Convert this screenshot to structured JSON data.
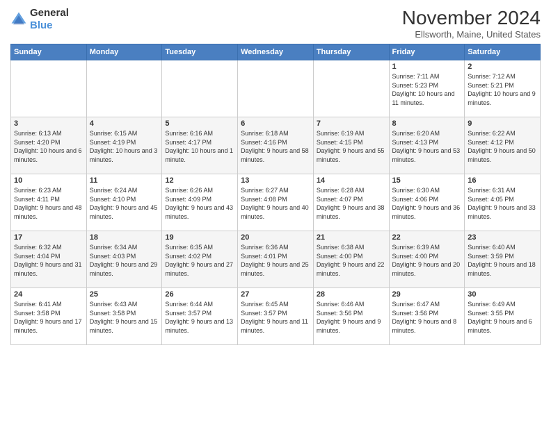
{
  "header": {
    "logo_general": "General",
    "logo_blue": "Blue",
    "title": "November 2024",
    "location": "Ellsworth, Maine, United States"
  },
  "weekdays": [
    "Sunday",
    "Monday",
    "Tuesday",
    "Wednesday",
    "Thursday",
    "Friday",
    "Saturday"
  ],
  "weeks": [
    [
      {
        "day": "",
        "info": ""
      },
      {
        "day": "",
        "info": ""
      },
      {
        "day": "",
        "info": ""
      },
      {
        "day": "",
        "info": ""
      },
      {
        "day": "",
        "info": ""
      },
      {
        "day": "1",
        "info": "Sunrise: 7:11 AM\nSunset: 5:23 PM\nDaylight: 10 hours and 11 minutes."
      },
      {
        "day": "2",
        "info": "Sunrise: 7:12 AM\nSunset: 5:21 PM\nDaylight: 10 hours and 9 minutes."
      }
    ],
    [
      {
        "day": "3",
        "info": "Sunrise: 6:13 AM\nSunset: 4:20 PM\nDaylight: 10 hours and 6 minutes."
      },
      {
        "day": "4",
        "info": "Sunrise: 6:15 AM\nSunset: 4:19 PM\nDaylight: 10 hours and 3 minutes."
      },
      {
        "day": "5",
        "info": "Sunrise: 6:16 AM\nSunset: 4:17 PM\nDaylight: 10 hours and 1 minute."
      },
      {
        "day": "6",
        "info": "Sunrise: 6:18 AM\nSunset: 4:16 PM\nDaylight: 9 hours and 58 minutes."
      },
      {
        "day": "7",
        "info": "Sunrise: 6:19 AM\nSunset: 4:15 PM\nDaylight: 9 hours and 55 minutes."
      },
      {
        "day": "8",
        "info": "Sunrise: 6:20 AM\nSunset: 4:13 PM\nDaylight: 9 hours and 53 minutes."
      },
      {
        "day": "9",
        "info": "Sunrise: 6:22 AM\nSunset: 4:12 PM\nDaylight: 9 hours and 50 minutes."
      }
    ],
    [
      {
        "day": "10",
        "info": "Sunrise: 6:23 AM\nSunset: 4:11 PM\nDaylight: 9 hours and 48 minutes."
      },
      {
        "day": "11",
        "info": "Sunrise: 6:24 AM\nSunset: 4:10 PM\nDaylight: 9 hours and 45 minutes."
      },
      {
        "day": "12",
        "info": "Sunrise: 6:26 AM\nSunset: 4:09 PM\nDaylight: 9 hours and 43 minutes."
      },
      {
        "day": "13",
        "info": "Sunrise: 6:27 AM\nSunset: 4:08 PM\nDaylight: 9 hours and 40 minutes."
      },
      {
        "day": "14",
        "info": "Sunrise: 6:28 AM\nSunset: 4:07 PM\nDaylight: 9 hours and 38 minutes."
      },
      {
        "day": "15",
        "info": "Sunrise: 6:30 AM\nSunset: 4:06 PM\nDaylight: 9 hours and 36 minutes."
      },
      {
        "day": "16",
        "info": "Sunrise: 6:31 AM\nSunset: 4:05 PM\nDaylight: 9 hours and 33 minutes."
      }
    ],
    [
      {
        "day": "17",
        "info": "Sunrise: 6:32 AM\nSunset: 4:04 PM\nDaylight: 9 hours and 31 minutes."
      },
      {
        "day": "18",
        "info": "Sunrise: 6:34 AM\nSunset: 4:03 PM\nDaylight: 9 hours and 29 minutes."
      },
      {
        "day": "19",
        "info": "Sunrise: 6:35 AM\nSunset: 4:02 PM\nDaylight: 9 hours and 27 minutes."
      },
      {
        "day": "20",
        "info": "Sunrise: 6:36 AM\nSunset: 4:01 PM\nDaylight: 9 hours and 25 minutes."
      },
      {
        "day": "21",
        "info": "Sunrise: 6:38 AM\nSunset: 4:00 PM\nDaylight: 9 hours and 22 minutes."
      },
      {
        "day": "22",
        "info": "Sunrise: 6:39 AM\nSunset: 4:00 PM\nDaylight: 9 hours and 20 minutes."
      },
      {
        "day": "23",
        "info": "Sunrise: 6:40 AM\nSunset: 3:59 PM\nDaylight: 9 hours and 18 minutes."
      }
    ],
    [
      {
        "day": "24",
        "info": "Sunrise: 6:41 AM\nSunset: 3:58 PM\nDaylight: 9 hours and 17 minutes."
      },
      {
        "day": "25",
        "info": "Sunrise: 6:43 AM\nSunset: 3:58 PM\nDaylight: 9 hours and 15 minutes."
      },
      {
        "day": "26",
        "info": "Sunrise: 6:44 AM\nSunset: 3:57 PM\nDaylight: 9 hours and 13 minutes."
      },
      {
        "day": "27",
        "info": "Sunrise: 6:45 AM\nSunset: 3:57 PM\nDaylight: 9 hours and 11 minutes."
      },
      {
        "day": "28",
        "info": "Sunrise: 6:46 AM\nSunset: 3:56 PM\nDaylight: 9 hours and 9 minutes."
      },
      {
        "day": "29",
        "info": "Sunrise: 6:47 AM\nSunset: 3:56 PM\nDaylight: 9 hours and 8 minutes."
      },
      {
        "day": "30",
        "info": "Sunrise: 6:49 AM\nSunset: 3:55 PM\nDaylight: 9 hours and 6 minutes."
      }
    ]
  ]
}
